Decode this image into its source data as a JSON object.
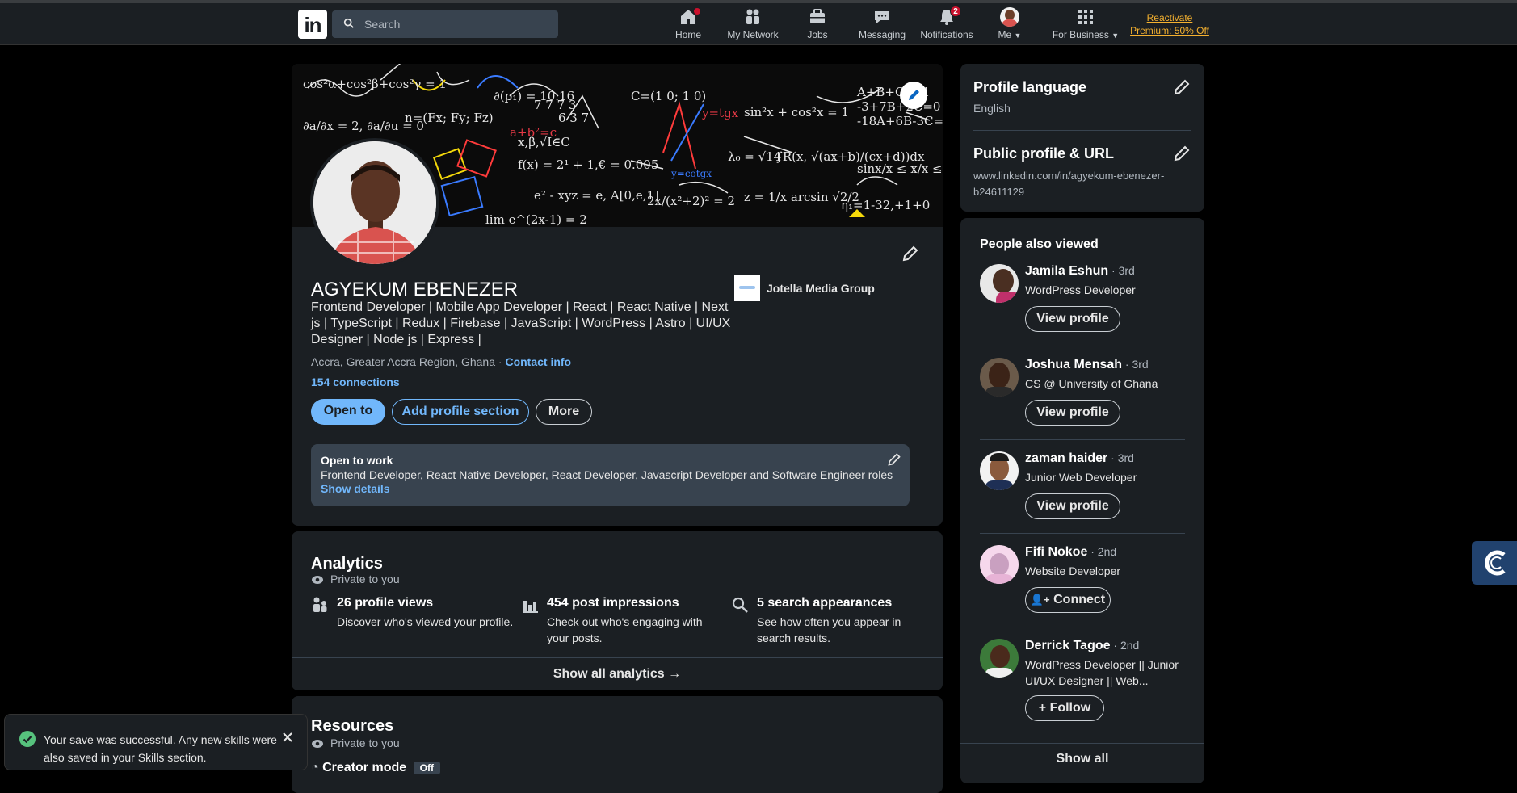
{
  "nav": {
    "search_placeholder": "Search",
    "items": [
      {
        "label": "Home",
        "icon": "home-icon",
        "badge": ""
      },
      {
        "label": "My Network",
        "icon": "network-icon"
      },
      {
        "label": "Jobs",
        "icon": "briefcase-icon"
      },
      {
        "label": "Messaging",
        "icon": "messaging-icon"
      },
      {
        "label": "Notifications",
        "icon": "bell-icon",
        "badge": "2"
      },
      {
        "label": "Me",
        "icon": "avatar"
      },
      {
        "label": "For Business",
        "icon": "grid-icon"
      }
    ],
    "premium_line1": "Reactivate",
    "premium_line2": "Premium: 50% Off"
  },
  "profile": {
    "name": "AGYEKUM EBENEZER",
    "headline": "Frontend Developer | Mobile App Developer | React | React Native | Next js | TypeScript | Redux | Firebase | JavaScript | WordPress | Astro | UI/UX Designer | Node js | Express |",
    "company": "Jotella Media Group",
    "location": "Accra, Greater Accra Region, Ghana",
    "location_sep": " · ",
    "contact_info": "Contact info",
    "connections": "154 connections",
    "buttons": {
      "open_to": "Open to",
      "add_section": "Add profile section",
      "more": "More"
    },
    "open_to_work": {
      "title": "Open to work",
      "roles": "Frontend Developer, React Native Developer, React Developer, Javascript Developer and Software Engineer roles",
      "details_link": "Show details"
    }
  },
  "analytics": {
    "title": "Analytics",
    "private": "Private to you",
    "stats": [
      {
        "title": "26 profile views",
        "desc": "Discover who's viewed your profile.",
        "icon": "people-icon"
      },
      {
        "title": "454 post impressions",
        "desc": "Check out who's engaging with your posts.",
        "icon": "bar-chart-icon"
      },
      {
        "title": "5 search appearances",
        "desc": "See how often you appear in search results.",
        "icon": "search-icon"
      }
    ],
    "show_all": "Show all analytics →"
  },
  "resources": {
    "title": "Resources",
    "private": "Private to you",
    "creator_mode": "Creator mode",
    "creator_state": "Off"
  },
  "sidebar": {
    "profile_language_title": "Profile language",
    "profile_language_value": "English",
    "public_profile_title": "Public profile & URL",
    "public_profile_url_1": "www.linkedin.com/in/agyekum-ebenezer-",
    "public_profile_url_2": "b24611129",
    "pav_title": "People also viewed",
    "people": [
      {
        "name": "Jamila Eshun",
        "degree": " · 3rd",
        "desc": "WordPress Developer",
        "button": "View profile"
      },
      {
        "name": "Joshua Mensah",
        "degree": " · 3rd",
        "desc": "CS @ University of Ghana",
        "button": "View profile"
      },
      {
        "name": "zaman haider",
        "degree": " · 3rd",
        "desc": "Junior Web Developer",
        "button": "View profile"
      },
      {
        "name": "Fifi Nokoe",
        "degree": " · 2nd",
        "desc": "Website Developer",
        "button": "Connect"
      },
      {
        "name": "Derrick Tagoe",
        "degree": " · 2nd",
        "desc": "WordPress Developer || Junior UI/UX Designer || Web...",
        "button": "Follow"
      }
    ],
    "show_all": "Show all"
  },
  "toast": {
    "message": "Your save was successful. Any new skills were also saved in your Skills section."
  },
  "colors": {
    "accent": "#71b7fb",
    "background": "#000000",
    "card": "#1b1f23",
    "premium": "#f5b12f",
    "success": "#57c27d"
  }
}
